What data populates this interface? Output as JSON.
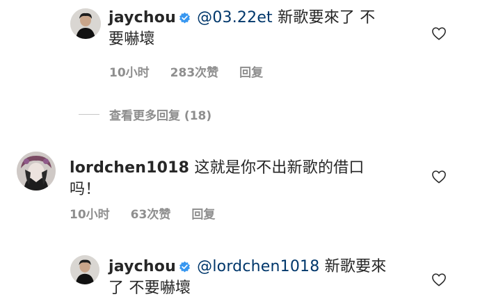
{
  "comments": [
    {
      "username": "jaychou",
      "mention": "@03.22et",
      "text_line1": "新歌要來了 不",
      "text_line2": "要嚇壞",
      "time": "10小时",
      "likes": "283次赞",
      "reply": "回复"
    },
    {
      "username": "lordchen1018",
      "text_line1": "这就是你不出新歌的借口",
      "text_line2": "吗！",
      "time": "10小时",
      "likes": "63次赞",
      "reply": "回复"
    },
    {
      "username": "jaychou",
      "mention": "@lordchen1018",
      "text_line1": "新歌要來",
      "text_line2": "了 不要嚇壞"
    }
  ],
  "view_more_replies": "查看更多回复 (18)",
  "icons": {
    "verified": "verified-badge-icon",
    "like": "heart-outline-icon"
  },
  "colors": {
    "text": "#262626",
    "meta": "#8e8e8e",
    "mention": "#00376b",
    "verified": "#3897f0"
  }
}
